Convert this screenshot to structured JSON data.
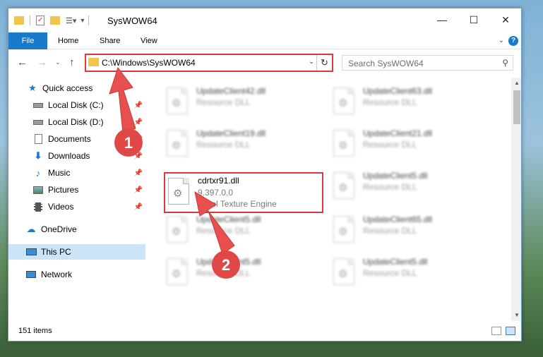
{
  "window": {
    "title": "SysWOW64",
    "controls": {
      "minimize": "—",
      "maximize": "☐",
      "close": "✕"
    }
  },
  "ribbon": {
    "tabs": [
      "File",
      "Home",
      "Share",
      "View"
    ],
    "help": "?"
  },
  "nav": {
    "address": "C:\\Windows\\SysWOW64",
    "search_placeholder": "Search SysWOW64"
  },
  "sidebar": {
    "items": [
      {
        "label": "Quick access",
        "icon": "star-icon"
      },
      {
        "label": "Local Disk (C:)",
        "icon": "drive-icon",
        "pinned": true
      },
      {
        "label": "Local Disk (D:)",
        "icon": "drive-icon",
        "pinned": true
      },
      {
        "label": "Documents",
        "icon": "documents-icon",
        "pinned": true
      },
      {
        "label": "Downloads",
        "icon": "download-icon",
        "pinned": true
      },
      {
        "label": "Music",
        "icon": "music-icon",
        "pinned": true
      },
      {
        "label": "Pictures",
        "icon": "pictures-icon",
        "pinned": true
      },
      {
        "label": "Videos",
        "icon": "videos-icon",
        "pinned": true
      },
      {
        "label": "OneDrive",
        "icon": "cloud-icon"
      },
      {
        "label": "This PC",
        "icon": "computer-icon",
        "selected": true
      },
      {
        "label": "Network",
        "icon": "network-icon"
      }
    ]
  },
  "files": {
    "highlighted": {
      "name": "cdrtxr91.dll",
      "version": "9.397.0.0",
      "description": "Corel Texture Engine"
    },
    "blurred": [
      {
        "name": "UpdateClient42.dll",
        "type": "Resource DLL"
      },
      {
        "name": "UpdateClient63.dll",
        "type": "Resource DLL"
      },
      {
        "name": "UpdateClient19.dll",
        "type": "Resource DLL"
      },
      {
        "name": "UpdateClient21.dll",
        "type": "Resource DLL"
      },
      {
        "name": "UpdateClient5.dll",
        "type": "Resource DLL"
      },
      {
        "name": "UpdateClient5.dll",
        "type": "Resource DLL"
      },
      {
        "name": "UpdateClient65.dll",
        "type": "Resource DLL"
      },
      {
        "name": "UpdateClient5.dll",
        "type": "Resource DLL"
      },
      {
        "name": "UpdateClient5.dll",
        "type": "Resource DLL"
      }
    ]
  },
  "status": {
    "item_count": "151 items"
  },
  "annotations": {
    "step1": "1",
    "step2": "2"
  },
  "colors": {
    "accent": "#1979ca",
    "highlight": "#d9393a",
    "selected": "#cce4f7"
  }
}
